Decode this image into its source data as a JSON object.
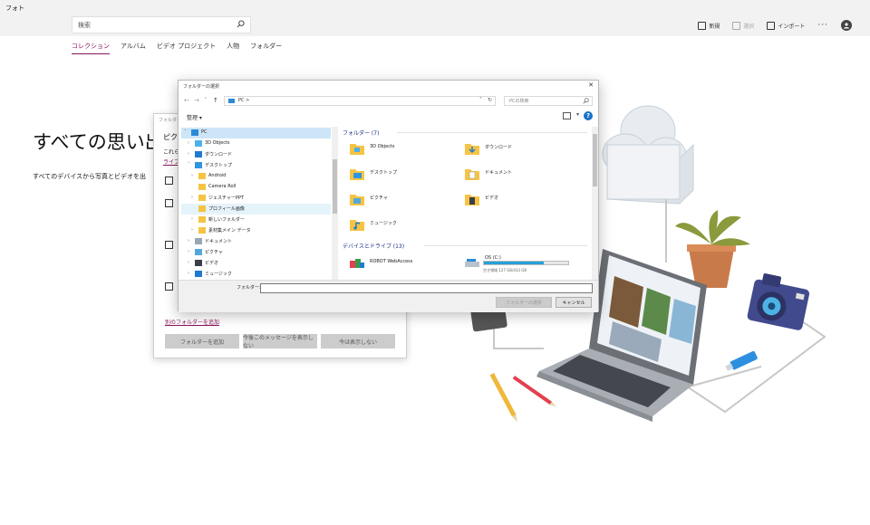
{
  "app": {
    "title": "フォト"
  },
  "search": {
    "value": "検索"
  },
  "top_actions": [
    {
      "label": "新規",
      "disabled": false
    },
    {
      "label": "選択",
      "disabled": true
    },
    {
      "label": "インポート",
      "disabled": false
    }
  ],
  "more_label": "···",
  "tabs": [
    {
      "label": "コレクション",
      "active": true
    },
    {
      "label": "アルバム",
      "active": false
    },
    {
      "label": "ビデオ プロジェクト",
      "active": false
    },
    {
      "label": "人物",
      "active": false
    },
    {
      "label": "フォルダー",
      "active": false
    }
  ],
  "main": {
    "title": "すべての思い出",
    "subtitle": "すべてのデバイスから写真とビデオを出"
  },
  "bg_dialog": {
    "title": "フォルダーを追加",
    "heading": "ピク",
    "sub": "これら",
    "link1": "ライブ",
    "link2": "別のフォルダーを追加",
    "buttons": [
      "フォルダーを追加",
      "今後このメッセージを表示しない",
      "今は表示しない"
    ]
  },
  "file_dialog": {
    "title": "フォルダーの選択",
    "close": "✕",
    "address": "PC  >",
    "search_placeholder": "PCの検索",
    "organize": "整理 ▾",
    "help": "?",
    "nav_items": [
      {
        "label": "PC",
        "selected": true
      },
      {
        "label": "3D Objects"
      },
      {
        "label": "ダウンロード"
      },
      {
        "label": "デスクトップ"
      },
      {
        "label": "Android"
      },
      {
        "label": "Camera Roll"
      },
      {
        "label": "ジェスチャーPPT"
      },
      {
        "label": "プロフィール画像",
        "hover": true
      },
      {
        "label": "新しいフォルダー"
      },
      {
        "label": "素材集メイン データ"
      },
      {
        "label": "ドキュメント"
      },
      {
        "label": "ピクチャ"
      },
      {
        "label": "ビデオ"
      },
      {
        "label": "ミュージック"
      }
    ],
    "groups": {
      "folders": "フォルダー (7)",
      "drives": "デバイスとドライブ (13)"
    },
    "folders": [
      {
        "label": "3D Objects"
      },
      {
        "label": "ダウンロード"
      },
      {
        "label": "デスクトップ"
      },
      {
        "label": "ドキュメント"
      },
      {
        "label": "ピクチャ"
      },
      {
        "label": "ビデオ"
      },
      {
        "label": "ミュージック"
      }
    ],
    "drives": [
      {
        "label": "ROBOT WebAccess"
      },
      {
        "label": "OS (C:)",
        "usage_fraction": 0.71,
        "free_text": "空き領域 127 GB/433 GB"
      }
    ],
    "folder_field_label": "フォルダー:",
    "folder_field_value": "",
    "select_button": "フォルダーの選択",
    "cancel_button": "キャンセル"
  },
  "colors": {
    "accent": "#8a1558",
    "selection": "#cde6f7",
    "drive_bar": "#26a0da",
    "folder": "#f5c443"
  }
}
